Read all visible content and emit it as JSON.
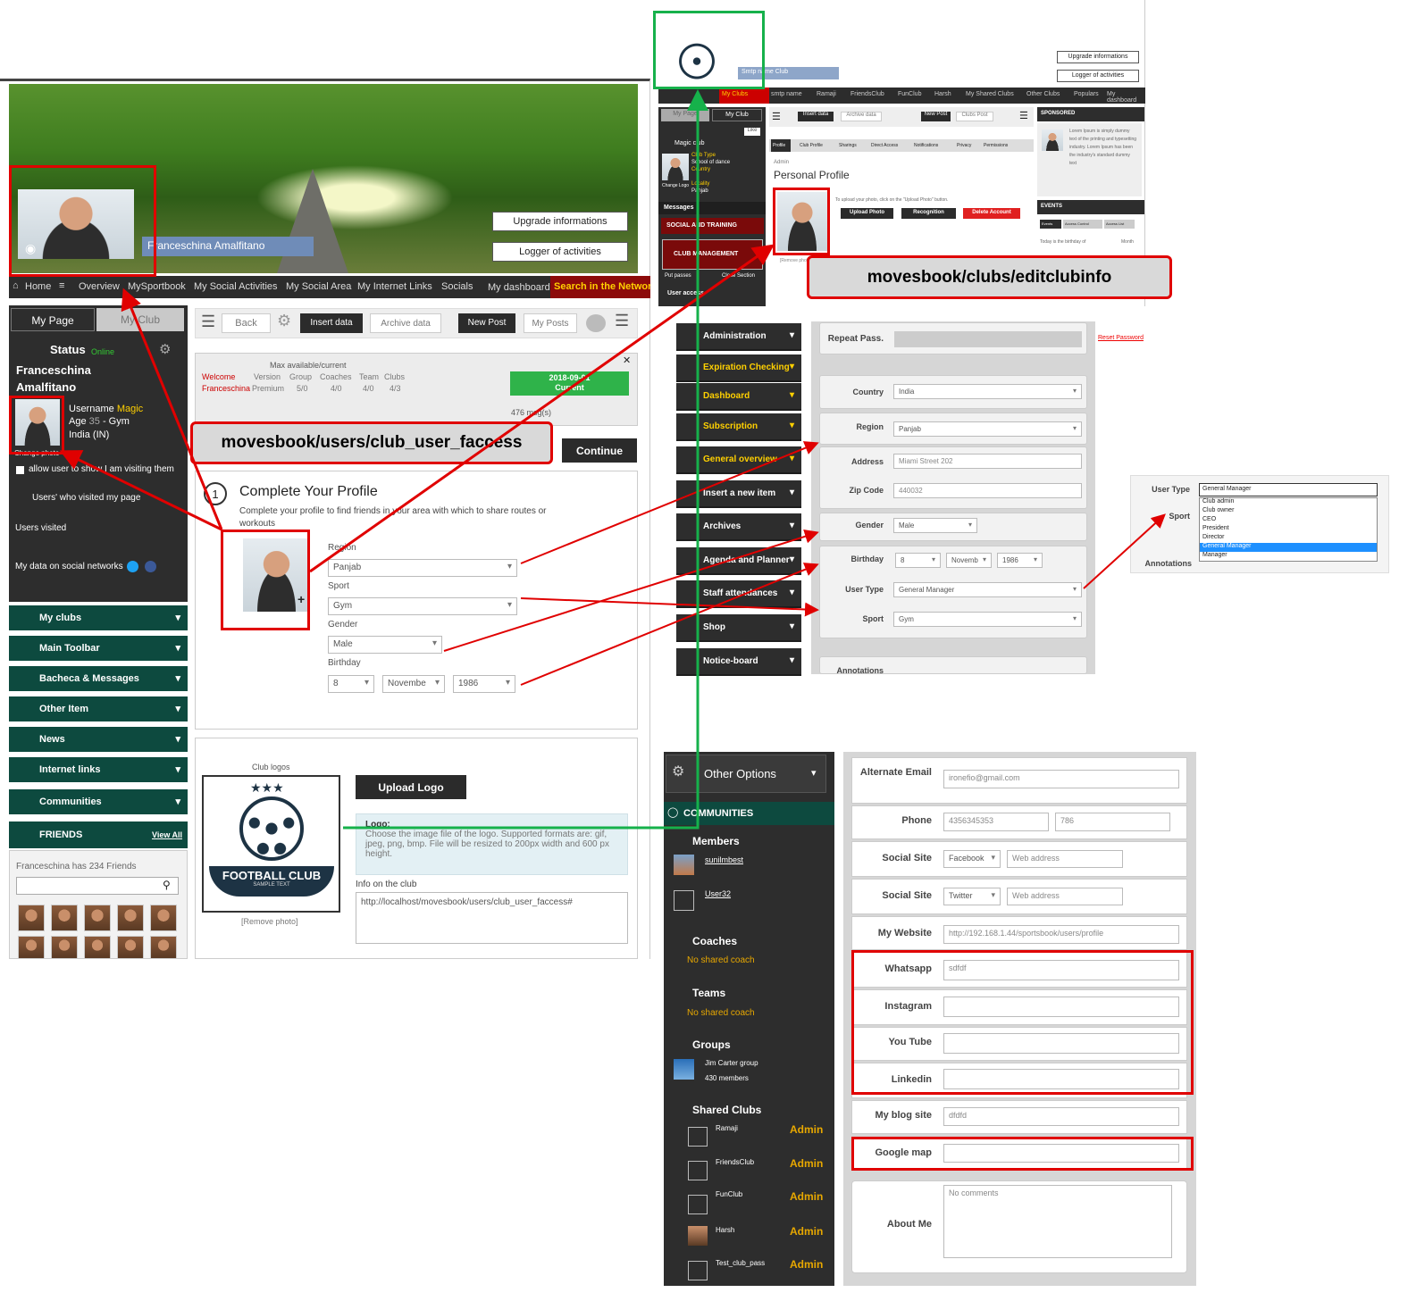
{
  "profile_page": {
    "user_name": "Franceschina Amalfitano",
    "upgrade_button": "Upgrade informations",
    "logger_button": "Logger of activities",
    "nav": [
      "Home",
      "Overview",
      "MySportbook",
      "My Social Activities",
      "My Social Area",
      "My Internet Links",
      "Socials",
      "My dashboard"
    ],
    "search_network": "Search in the Network",
    "tabs": {
      "my_page": "My Page",
      "my_club": "My Club"
    },
    "status": {
      "title": "Status",
      "online": "Online"
    },
    "sidebar_name": "Franceschina Amalfitano",
    "username_label": "Username",
    "username_value": "Magic",
    "age_label": "Age",
    "age_value": "35",
    "age_suffix": "- Gym",
    "country": "India (IN)",
    "change_photo": "Change photo",
    "allow_text": "allow user to show I am visiting them",
    "visited_text": "Users' who visited my page",
    "users_visited": "Users visited",
    "social_networks": "My data on social networks",
    "menu": [
      "My clubs",
      "Main Toolbar",
      "Bacheca & Messages",
      "Other Item",
      "News",
      "Internet links",
      "Communities"
    ],
    "friends": {
      "title": "FRIENDS",
      "view_all": "View All",
      "count_text": "Franceschina has 234 Friends"
    },
    "toolbar": {
      "back": "Back",
      "insert": "Insert data",
      "archive": "Archive data",
      "new_post": "New Post",
      "my_posts": "My Posts"
    },
    "welcome": {
      "label": "Welcome",
      "name": "Franceschina",
      "headline": "Max available/current",
      "cols": [
        "Version",
        "Group",
        "Coaches",
        "Team",
        "Clubs"
      ],
      "vals": [
        "Premium",
        "5/0",
        "4/0",
        "4/0",
        "4/3"
      ],
      "date": "2018-09-01",
      "current": "Current",
      "msgs": "476 msg(s)"
    },
    "continue_button": "Continue",
    "complete": {
      "step": "1",
      "title": "Complete Your Profile",
      "desc": "Complete your profile to find friends in your area with which to share routes or workouts"
    },
    "form": {
      "region_label": "Region",
      "region": "Panjab",
      "sport_label": "Sport",
      "sport": "Gym",
      "gender_label": "Gender",
      "gender": "Male",
      "birthday_label": "Birthday",
      "day": "8",
      "month": "Novembe",
      "year": "1986"
    },
    "logo": {
      "caption": "Club logos",
      "text_main": "FOOTBALL CLUB",
      "text_sub": "SAMPLE TEXT",
      "remove": "[Remove photo]",
      "upload": "Upload Logo",
      "info_title": "Logo:",
      "info_text": "Choose the image file of the logo. Supported formats are: gif, jpeg, png, bmp. File will be resized to 200px width and 600 px height.",
      "club_info_label": "Info on the club",
      "club_info_value": "http://localhost/movesbook/users/club_user_faccess#"
    }
  },
  "annotation_left": "movesbook/users/club_user_faccess",
  "annotation_right": "movesbook/clubs/editclubinfo",
  "club_page": {
    "club_name": "Smtp name Club",
    "upgrade": "Upgrade informations",
    "logger": "Logger of activities",
    "nav": [
      "My Clubs",
      "smtp name",
      "Ramaji",
      "FriendsClub",
      "FunClub",
      "Harsh",
      "My Shared Clubs",
      "Other Clubs",
      "Populars",
      "My dashboard"
    ],
    "tabs": {
      "my_page": "My Page",
      "my_club": "My Club",
      "like": "Like"
    },
    "club_label": "Magic club",
    "club_type": "Club Type",
    "club_type_val": "School of dance",
    "country": "Country",
    "locality": "Locality",
    "locality_val": "Panjab",
    "change_logo": "Change Logo",
    "messages": "Messages",
    "social_training": "SOCIAL AND TRAINING",
    "club_management": "CLUB MANAGEMENT",
    "put_passes": "Put passes",
    "close_section": "Close Section",
    "users": "User access",
    "sub_tabs": [
      "Profile",
      "Club Profile",
      "Sharings",
      "Direct Access",
      "Notifications",
      "Privacy",
      "Permissions"
    ],
    "admin_label": "Admin",
    "personal_profile": "Personal Profile",
    "upload_hint": "To upload your photo, click on the \"Upload Photo\" button.",
    "upload_photo": "Upload Photo",
    "recognition": "Recognition",
    "delete_account": "Delete Account",
    "remove_photo": "[Remove photo]",
    "sponsored": "SPONSORED",
    "sponsored_text": "Lorem Ipsum is simply dummy text of the printing and typesetting industry. Lorem Ipsum has been the industry's standard dummy text",
    "events": "EVENTS",
    "events_tabs": [
      "Events",
      "Access Control",
      "Access List"
    ],
    "birthday_text": "Today is the birthday of",
    "month": "Month",
    "insert": "Insert data",
    "archive": "Archive data",
    "new_post": "New Post",
    "clubs_post": "Clubs Post"
  },
  "admin_menu": [
    "Administration",
    "Expiration Checking",
    "Dashboard",
    "Subscription",
    "General overview",
    "Insert a new item",
    "Archives",
    "Agenda and Planner",
    "Staff attendances",
    "Shop",
    "Notice-board"
  ],
  "edit_form": {
    "repeat_pass": "Repeat Pass.",
    "reset_password": "Reset Password",
    "country_label": "Country",
    "country": "India",
    "region_label": "Region",
    "region": "Panjab",
    "address_label": "Address",
    "address": "Miami Street 202",
    "zip_label": "Zip Code",
    "zip": "440032",
    "gender_label": "Gender",
    "gender": "Male",
    "birthday_label": "Birthday",
    "day": "8",
    "month": "Novemb",
    "year": "1986",
    "usertype_label": "User Type",
    "usertype": "General Manager",
    "sport_label": "Sport",
    "sport": "Gym",
    "annotations_label": "Annotations"
  },
  "usertype_dropdown": {
    "label": "User Type",
    "value": "General Manager",
    "sport_label": "Sport",
    "annotations_label": "Annotations",
    "options": [
      "Club admin",
      "Club owner",
      "CEO",
      "President",
      "Director",
      "General Manager",
      "Manager"
    ],
    "selected": "General Manager"
  },
  "lower": {
    "other_options": "Other Options",
    "communities": "COMMUNITIES",
    "members": "Members",
    "member1": "sunilmbest",
    "member2": "User32",
    "coaches": "Coaches",
    "no_coach": "No shared coach",
    "teams": "Teams",
    "no_team": "No shared coach",
    "groups": "Groups",
    "group_name": "Jim Carter group",
    "group_members": "430 members",
    "shared_clubs": "Shared Clubs",
    "clubs": [
      {
        "name": "Ramaji",
        "role": "Admin"
      },
      {
        "name": "FriendsClub",
        "role": "Admin"
      },
      {
        "name": "FunClub",
        "role": "Admin"
      },
      {
        "name": "Harsh",
        "role": "Admin"
      },
      {
        "name": "Test_club_pass",
        "role": "Admin"
      }
    ],
    "alt_email_label": "Alternate Email",
    "alt_email": "ironefio@gmail.com",
    "phone_label": "Phone",
    "phone": "4356345353",
    "phone2": "786",
    "social_label": "Social Site",
    "social1": "Facebook",
    "social2": "Twitter",
    "web_placeholder": "Web address",
    "website_label": "My Website",
    "website": "http://192.168.1.44/sportsbook/users/profile",
    "whatsapp_label": "Whatsapp",
    "whatsapp": "sdfdf",
    "instagram_label": "Instagram",
    "youtube_label": "You Tube",
    "linkedin_label": "Linkedin",
    "blog_label": "My blog site",
    "blog": "dfdfd",
    "gmap_label": "Google map",
    "about_label": "About Me",
    "about_placeholder": "No comments"
  }
}
